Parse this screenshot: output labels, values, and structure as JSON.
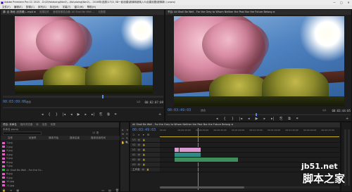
{
  "app": {
    "title_bar": "Adobe Premiere Pro CC 2015 - D:\\2\\Helaloing\\Ner2\\...\\Ko\\aloing\\Ner2\\... 2016年\\选剪\\17\\1\\ 3D一起创建\\超清新超纯入5\\合建设据\\超清新\\ \\ prproj",
    "win_controls": [
      "—",
      "□",
      "✕"
    ]
  },
  "menu": [
    "文件(F)",
    "编辑(E)",
    "剪辑(C)",
    "序列(S)",
    "标记(M)",
    "字幕(T)",
    "窗口(W)",
    "帮助(H)"
  ],
  "source_panel": {
    "tabs": [
      "源: 合 场地 (无剪辑)...mp4 ≡",
      "效果控件",
      "音频剪辑混合器: All Shall Be Well ...",
      "元数据"
    ],
    "timecode_left": "00:03:09:06",
    "fit_label": "适合",
    "page_label": "1/2",
    "timecode_right": "00:02:07:09"
  },
  "program_panel": {
    "tabs": [
      "节目: All Shall Be Well - For the Grey to Whom Neither the Past Nor the Future Belong ≡"
    ],
    "timecode_left": "00:03:49:03",
    "fit_label": "适合",
    "page_label": "1/2",
    "timecode_right": "00:03:44:05"
  },
  "transport_icons": [
    "◂",
    "{",
    "}",
    "|◂",
    "◂",
    "▶",
    "▸",
    "▸|",
    "⎘",
    "⧉",
    "⌗",
    "+"
  ],
  "project_panel": {
    "tabs": [
      "项目: 未命名",
      "媒体浏览器",
      "库",
      "信息",
      "效果"
    ],
    "project_name": "未命名.prproj",
    "item_count": "17 项",
    "search_placeholder": "",
    "columns": [
      "名称",
      "帧速率",
      "媒体开始",
      "媒体结束",
      "媒体持续时间"
    ],
    "rows": [
      {
        "name": "1.jpg",
        "color": "#e25fc8"
      },
      {
        "name": "2.jpg",
        "color": "#e25fc8"
      },
      {
        "name": "3.jpg",
        "color": "#e25fc8"
      },
      {
        "name": "4.jpg",
        "color": "#e25fc8"
      },
      {
        "name": "5.jpg",
        "color": "#e25fc8"
      },
      {
        "name": "6.jpg",
        "color": "#e25fc8"
      },
      {
        "name": "7.jpg",
        "color": "#e25fc8"
      },
      {
        "name": "All Shall Be Well - For the Gr...",
        "color": "#3bb54a"
      },
      {
        "name": "8.jpg",
        "color": "#e25fc8"
      },
      {
        "name": "9.jpg",
        "color": "#e25fc8"
      },
      {
        "name": "10.jpg",
        "color": "#e25fc8"
      },
      {
        "name": "11.jpg",
        "color": "#e25fc8"
      }
    ]
  },
  "tools": [
    "▸",
    "⇥",
    "⇹",
    "✂",
    "⇿",
    "✎",
    "✋",
    "🔍"
  ],
  "timeline": {
    "tab": "All Shall Be Well - For the Grey to Whom Neither the Past Nor the Future Belong ≡",
    "timecode": "00:03:49:03",
    "ruler": [
      "00:00",
      "00:00:15:00",
      "00:00:30:00",
      "00:00:45:00",
      "00:01:00:00",
      "00:01:15:00",
      "00:01:30:00",
      "00:01:45:00",
      "00:02:00:00",
      "00:02:15:00"
    ],
    "tracks": [
      {
        "label": "V3",
        "kind": "video"
      },
      {
        "label": "V2",
        "kind": "video"
      },
      {
        "label": "V1",
        "kind": "video"
      },
      {
        "label": "A1",
        "kind": "audio"
      },
      {
        "label": "A2",
        "kind": "audio"
      },
      {
        "label": "A3",
        "kind": "audio"
      },
      {
        "label": "主声道",
        "kind": "master"
      }
    ]
  },
  "watermark": {
    "site": "jb51.net",
    "name": "脚本之家"
  },
  "colors": {
    "accent_blue": "#4f8ef2",
    "panel_bg": "#1d1d1d",
    "clip_pink": "#d99ad0",
    "clip_green": "#3e8d5a",
    "clip_teal": "#2f8a86"
  }
}
